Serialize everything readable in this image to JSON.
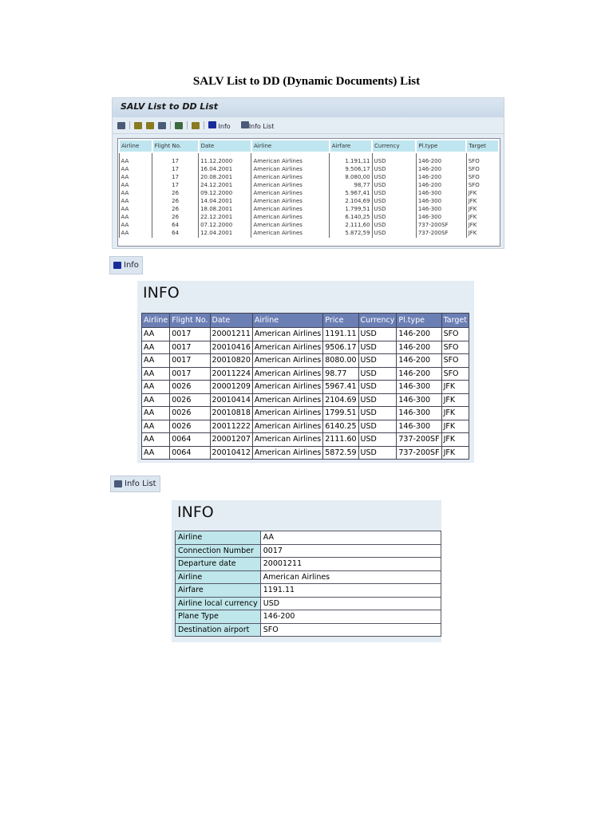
{
  "page_title": "SALV List to DD (Dynamic Documents) List",
  "salv": {
    "header": "SALV List to DD List",
    "toolbar": {
      "info_label": "Info",
      "info_list_label": "Info List"
    },
    "columns": [
      "Airline",
      "Flight No.",
      "Date",
      "Airline",
      "Airfare",
      "Currency",
      "Pl.type",
      "Target"
    ],
    "rows": [
      [
        "AA",
        "17",
        "11.12.2000",
        "American Airlines",
        "1.191,11",
        "USD",
        "146-200",
        "SFO"
      ],
      [
        "AA",
        "17",
        "16.04.2001",
        "American Airlines",
        "9.506,17",
        "USD",
        "146-200",
        "SFO"
      ],
      [
        "AA",
        "17",
        "20.08.2001",
        "American Airlines",
        "8.080,00",
        "USD",
        "146-200",
        "SFO"
      ],
      [
        "AA",
        "17",
        "24.12.2001",
        "American Airlines",
        "98,77",
        "USD",
        "146-200",
        "SFO"
      ],
      [
        "AA",
        "26",
        "09.12.2000",
        "American Airlines",
        "5.967,41",
        "USD",
        "146-300",
        "JFK"
      ],
      [
        "AA",
        "26",
        "14.04.2001",
        "American Airlines",
        "2.104,69",
        "USD",
        "146-300",
        "JFK"
      ],
      [
        "AA",
        "26",
        "18.08.2001",
        "American Airlines",
        "1.799,51",
        "USD",
        "146-300",
        "JFK"
      ],
      [
        "AA",
        "26",
        "22.12.2001",
        "American Airlines",
        "6.140,25",
        "USD",
        "146-300",
        "JFK"
      ],
      [
        "AA",
        "64",
        "07.12.2000",
        "American Airlines",
        "2.111,60",
        "USD",
        "737-200SF",
        "JFK"
      ],
      [
        "AA",
        "64",
        "12.04.2001",
        "American Airlines",
        "5.872,59",
        "USD",
        "737-200SF",
        "JFK"
      ]
    ]
  },
  "info_button": "Info",
  "info": {
    "title": "INFO",
    "columns": [
      "Airline",
      "Flight No.",
      "Date",
      "Airline",
      "Price",
      "Currency",
      "Pl.type",
      "Target"
    ],
    "rows": [
      [
        "AA",
        "0017",
        "20001211",
        "American Airlines",
        "1191.11",
        "USD",
        "146-200",
        "SFO"
      ],
      [
        "AA",
        "0017",
        "20010416",
        "American Airlines",
        "9506.17",
        "USD",
        "146-200",
        "SFO"
      ],
      [
        "AA",
        "0017",
        "20010820",
        "American Airlines",
        "8080.00",
        "USD",
        "146-200",
        "SFO"
      ],
      [
        "AA",
        "0017",
        "20011224",
        "American Airlines",
        "98.77",
        "USD",
        "146-200",
        "SFO"
      ],
      [
        "AA",
        "0026",
        "20001209",
        "American Airlines",
        "5967.41",
        "USD",
        "146-300",
        "JFK"
      ],
      [
        "AA",
        "0026",
        "20010414",
        "American Airlines",
        "2104.69",
        "USD",
        "146-300",
        "JFK"
      ],
      [
        "AA",
        "0026",
        "20010818",
        "American Airlines",
        "1799.51",
        "USD",
        "146-300",
        "JFK"
      ],
      [
        "AA",
        "0026",
        "20011222",
        "American Airlines",
        "6140.25",
        "USD",
        "146-300",
        "JFK"
      ],
      [
        "AA",
        "0064",
        "20001207",
        "American Airlines",
        "2111.60",
        "USD",
        "737-200SF",
        "JFK"
      ],
      [
        "AA",
        "0064",
        "20010412",
        "American Airlines",
        "5872.59",
        "USD",
        "737-200SF",
        "JFK"
      ]
    ]
  },
  "info_list_button": "Info List",
  "info_list": {
    "title": "INFO",
    "fields": [
      {
        "label": "Airline",
        "value": "AA"
      },
      {
        "label": "Connection Number",
        "value": "0017"
      },
      {
        "label": "Departure date",
        "value": "20001211"
      },
      {
        "label": "Airline",
        "value": "American Airlines"
      },
      {
        "label": "Airfare",
        "value": "1191.11"
      },
      {
        "label": "Airline local currency",
        "value": "USD"
      },
      {
        "label": "Plane Type",
        "value": "146-200"
      },
      {
        "label": "Destination airport",
        "value": "SFO"
      }
    ]
  }
}
